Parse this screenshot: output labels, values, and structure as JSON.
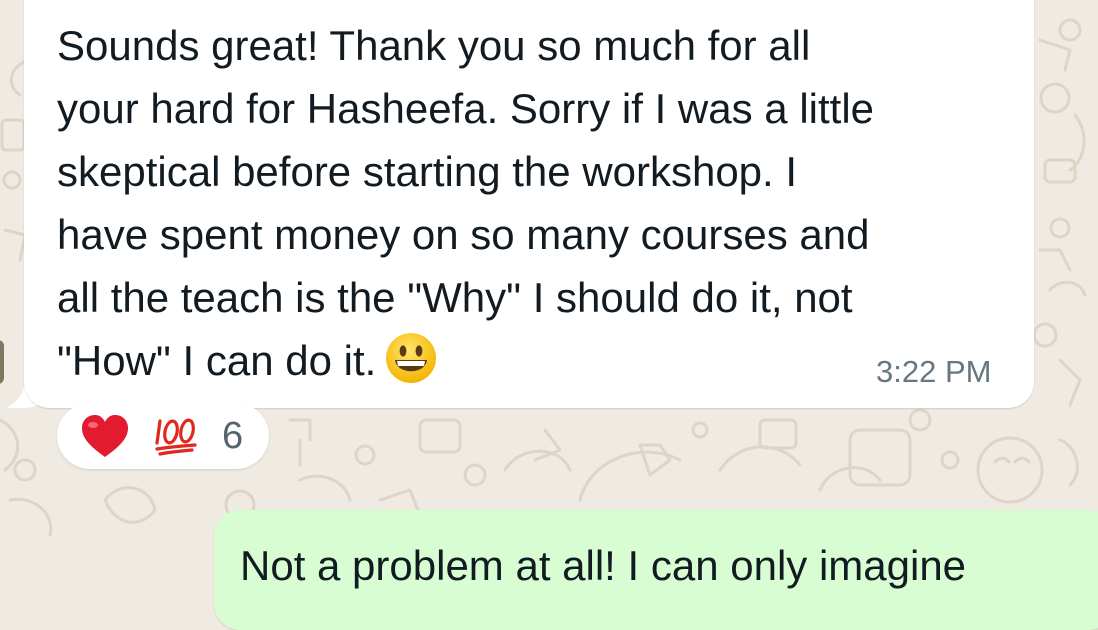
{
  "chat": {
    "background_color": "#efeae2",
    "incoming_bubble_color": "#ffffff",
    "outgoing_bubble_color": "#d9fdd3",
    "incoming": {
      "text": "Sounds great! Thank you so much for all\nyour hard for Hasheefa. Sorry if I was a little\nskeptical before starting the workshop. I\nhave spent money on so many courses and\nall the teach is the \"Why\" I should do it, not\n\"How\" I can do it.",
      "emoji": "grinning-face-emoji",
      "time": "3:22 PM",
      "reactions": {
        "first": "red-heart-emoji",
        "second": "hundred-points-emoji",
        "count": "6"
      }
    },
    "outgoing": {
      "text": "Not a problem at all! I can only imagine"
    }
  }
}
